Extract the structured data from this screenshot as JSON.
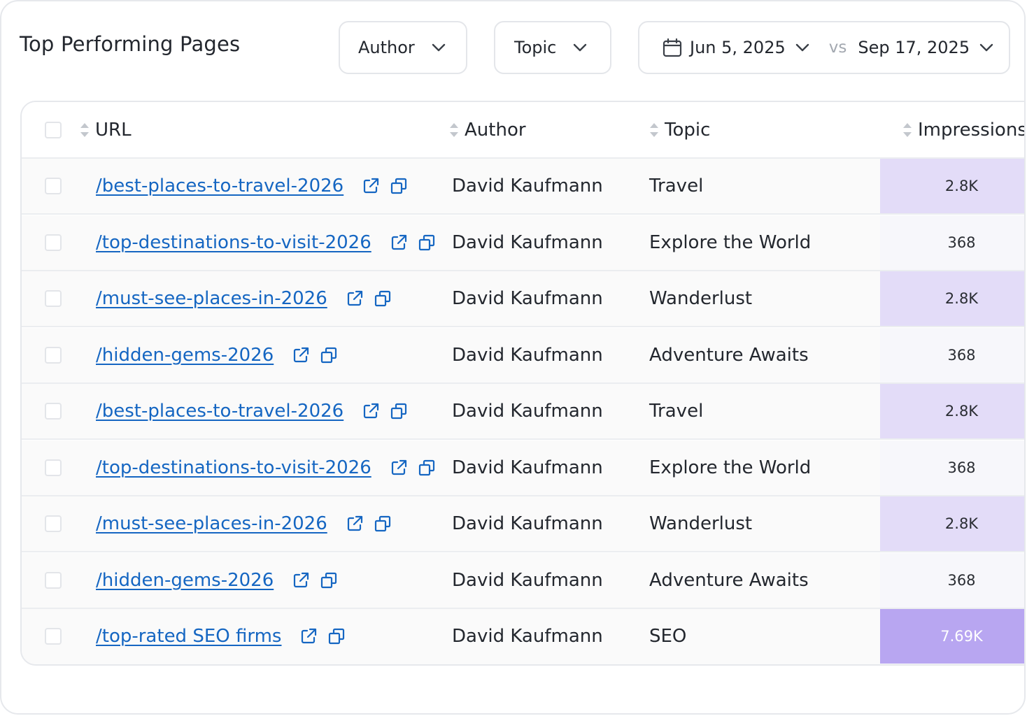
{
  "header": {
    "title": "Top Performing Pages",
    "filters": {
      "author_label": "Author",
      "topic_label": "Topic"
    },
    "date_range": {
      "start": "Jun 5, 2025",
      "vs": "vs",
      "end": "Sep 17, 2025"
    }
  },
  "table": {
    "columns": {
      "url": "URL",
      "author": "Author",
      "topic": "Topic",
      "impressions": "Impressions"
    },
    "rows": [
      {
        "url": "/best-places-to-travel-2026",
        "author": "David Kaufmann",
        "topic": "Travel",
        "impressions": "2.8K",
        "cell_color": "#e3dcf8",
        "text_color": "#2a2d33"
      },
      {
        "url": "/top-destinations-to-visit-2026",
        "author": "David Kaufmann",
        "topic": "Explore the World",
        "impressions": "368",
        "cell_color": "#f7f7fb",
        "text_color": "#2a2d33"
      },
      {
        "url": "/must-see-places-in-2026",
        "author": "David Kaufmann",
        "topic": "Wanderlust",
        "impressions": "2.8K",
        "cell_color": "#e3dcf8",
        "text_color": "#2a2d33"
      },
      {
        "url": "/hidden-gems-2026",
        "author": "David Kaufmann",
        "topic": "Adventure Awaits",
        "impressions": "368",
        "cell_color": "#f7f7fb",
        "text_color": "#2a2d33"
      },
      {
        "url": "/best-places-to-travel-2026",
        "author": "David Kaufmann",
        "topic": "Travel",
        "impressions": "2.8K",
        "cell_color": "#e3dcf8",
        "text_color": "#2a2d33"
      },
      {
        "url": "/top-destinations-to-visit-2026",
        "author": "David Kaufmann",
        "topic": "Explore the World",
        "impressions": "368",
        "cell_color": "#f7f7fb",
        "text_color": "#2a2d33"
      },
      {
        "url": "/must-see-places-in-2026",
        "author": "David Kaufmann",
        "topic": "Wanderlust",
        "impressions": "2.8K",
        "cell_color": "#e3dcf8",
        "text_color": "#2a2d33"
      },
      {
        "url": "/hidden-gems-2026",
        "author": "David Kaufmann",
        "topic": "Adventure Awaits",
        "impressions": "368",
        "cell_color": "#f7f7fb",
        "text_color": "#2a2d33"
      },
      {
        "url": "/top-rated SEO firms",
        "author": "David Kaufmann",
        "topic": "SEO",
        "impressions": "7.69K",
        "cell_color": "#b8a6f1",
        "text_color": "#ffffff"
      }
    ]
  },
  "colors": {
    "link": "#1566c2",
    "border": "#e6e8ec",
    "heat_low": "#f7f7fb",
    "heat_mid": "#e3dcf8",
    "heat_high": "#b8a6f1"
  },
  "icons": [
    "chevron-down-icon",
    "calendar-icon",
    "sort-icon",
    "external-link-icon",
    "copy-icon"
  ]
}
